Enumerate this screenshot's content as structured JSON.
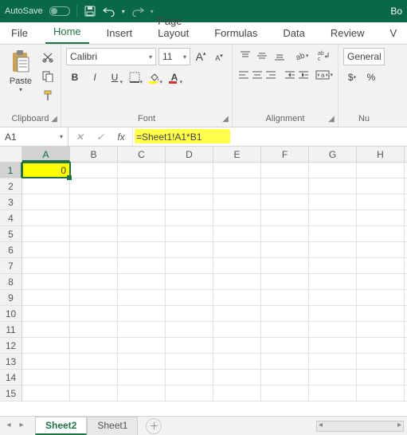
{
  "titlebar": {
    "autosave_label": "AutoSave",
    "autosave_state": "Off",
    "doc_title_partial": "Bo"
  },
  "tabs": {
    "file": "File",
    "home": "Home",
    "insert": "Insert",
    "page_layout": "Page Layout",
    "formulas": "Formulas",
    "data": "Data",
    "review": "Review",
    "view_partial": "V",
    "active": "Home"
  },
  "ribbon": {
    "clipboard": {
      "label": "Clipboard",
      "paste": "Paste"
    },
    "font": {
      "label": "Font",
      "name": "Calibri",
      "size": "11",
      "bold": "B",
      "italic": "I",
      "underline": "U",
      "highlight_color": "#ffff00",
      "text_color": "#d13438"
    },
    "alignment": {
      "label": "Alignment"
    },
    "number": {
      "label_partial": "Nu",
      "format": "General",
      "currency": "$",
      "percent": "%"
    }
  },
  "namebox": {
    "value": "A1"
  },
  "formula_bar": {
    "fx_label": "fx",
    "value": "=Sheet1!A1*B1"
  },
  "grid": {
    "columns": [
      "A",
      "B",
      "C",
      "D",
      "E",
      "F",
      "G",
      "H"
    ],
    "row_count": 15,
    "active_cell": "A1",
    "cells": {
      "A1": "0"
    },
    "highlighted_cells": [
      "A1"
    ]
  },
  "sheets": {
    "tabs": [
      "Sheet2",
      "Sheet1"
    ],
    "active": "Sheet2"
  }
}
